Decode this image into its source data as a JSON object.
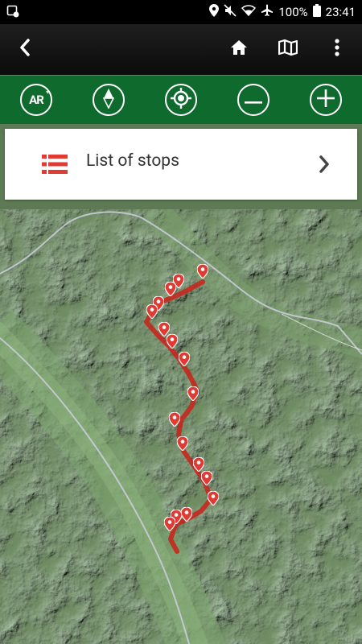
{
  "status_bar": {
    "battery_percent": "100%",
    "time": "23:41",
    "icons": [
      "sync-status-icon",
      "location-icon",
      "mute-icon",
      "wifi-icon",
      "airplane-icon",
      "battery-icon"
    ]
  },
  "toolbar": {
    "icons": [
      "back-icon",
      "home-icon",
      "map-icon",
      "more-vert-icon"
    ]
  },
  "action_bar": {
    "icons": [
      "ar-icon",
      "compass-icon",
      "locate-icon",
      "zoom-out-icon",
      "zoom-in-icon"
    ],
    "ar_label": "AR"
  },
  "list_card": {
    "label": "List of stops",
    "icons": [
      "list-icon",
      "chevron-right-icon"
    ]
  },
  "colors": {
    "toolbar": "#111111",
    "green_bar": "#0f6a2d",
    "accent_red": "#e03a32",
    "route": "#c4281e"
  }
}
